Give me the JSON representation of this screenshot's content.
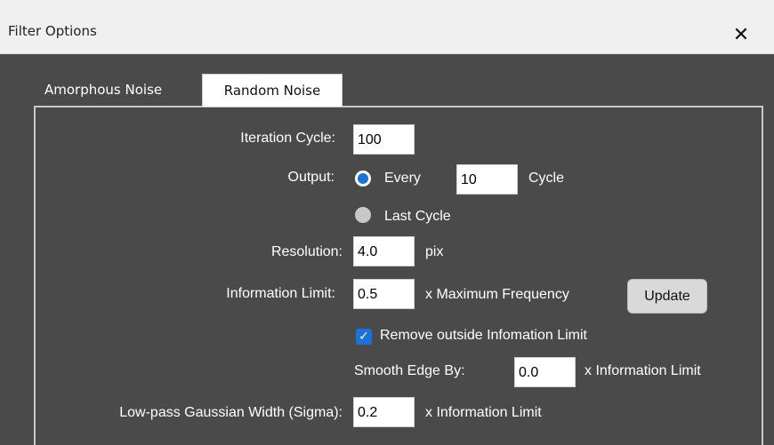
{
  "window": {
    "title": "Filter Options",
    "close_glyph": "✕"
  },
  "tabs": [
    {
      "label": "Amorphous Noise",
      "active": false
    },
    {
      "label": "Random Noise",
      "active": true
    }
  ],
  "form": {
    "iteration_cycle": {
      "label": "Iteration Cycle:",
      "value": "100"
    },
    "output": {
      "label": "Output:",
      "every": {
        "label": "Every",
        "value": "10",
        "suffix": "Cycle",
        "selected": true
      },
      "last_cycle": {
        "label": "Last Cycle",
        "selected": false
      }
    },
    "resolution": {
      "label": "Resolution:",
      "value": "4.0",
      "suffix": "pix"
    },
    "information_limit": {
      "label": "Information Limit:",
      "value": "0.5",
      "suffix": "x Maximum Frequency",
      "update_label": "Update"
    },
    "remove_outside": {
      "label": "Remove outside Infomation Limit",
      "checked": true,
      "check_glyph": "✓"
    },
    "smooth_edge": {
      "label": "Smooth Edge By:",
      "value": "0.0",
      "suffix": "x Information Limit"
    },
    "lowpass": {
      "label": "Low-pass Gaussian Width (Sigma):",
      "value": "0.2",
      "suffix": "x Information Limit"
    }
  },
  "colors": {
    "background": "#4a4a4a",
    "accent": "#1a73d6",
    "titlebar": "#f0f0f0"
  }
}
